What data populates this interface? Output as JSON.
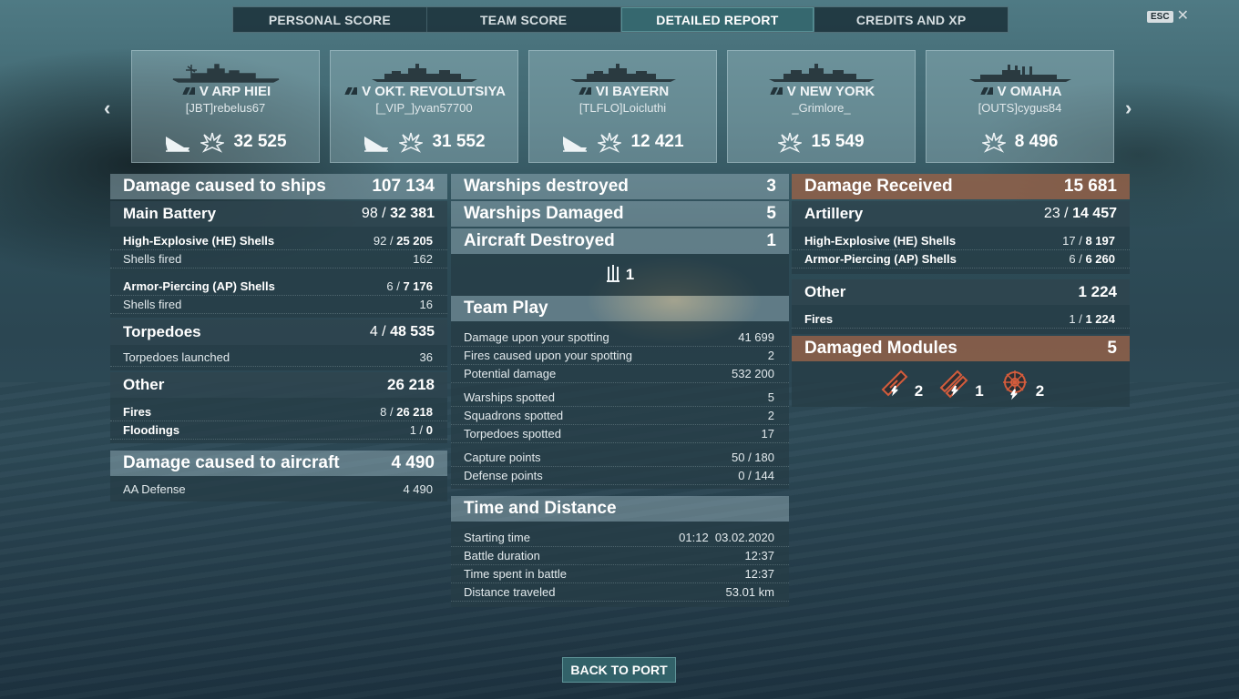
{
  "tabs": [
    "PERSONAL SCORE",
    "TEAM SCORE",
    "DETAILED REPORT",
    "CREDITS AND XP"
  ],
  "active_tab": 2,
  "esc_label": "ESC",
  "close_icon": "close-icon",
  "nav": {
    "prev_icon": "chevron-left-icon",
    "next_icon": "chevron-right-icon"
  },
  "ships": [
    {
      "tier_name": "V ARP HIEI",
      "player": "[JBT]rebelus67",
      "score": "32 525",
      "has_sunk_icon": true
    },
    {
      "tier_name": "V OKT. REVOLUTSIYA",
      "player": "[_VIP_]yvan57700",
      "score": "31 552",
      "has_sunk_icon": true
    },
    {
      "tier_name": "VI BAYERN",
      "player": "[TLFLO]Loicluthi",
      "score": "12 421",
      "has_sunk_icon": true
    },
    {
      "tier_name": "V NEW YORK",
      "player": "_Grimlore_",
      "score": "15 549",
      "has_sunk_icon": false
    },
    {
      "tier_name": "V OMAHA",
      "player": "[OUTS]cygus84",
      "score": "8 496",
      "has_sunk_icon": false
    }
  ],
  "damage_ships": {
    "title": "Damage caused to ships",
    "total": "107 134",
    "main_battery": {
      "label": "Main Battery",
      "hits": "98",
      "damage": "32 381"
    },
    "he": {
      "label": "High-Explosive (HE) Shells",
      "hits": "92",
      "damage": "25 205"
    },
    "he_fired": {
      "label": "Shells fired",
      "value": "162"
    },
    "ap": {
      "label": "Armor-Piercing (AP) Shells",
      "hits": "6",
      "damage": "7 176"
    },
    "ap_fired": {
      "label": "Shells fired",
      "value": "16"
    },
    "torpedoes": {
      "label": "Torpedoes",
      "hits": "4",
      "damage": "48 535"
    },
    "torp_launched": {
      "label": "Torpedoes launched",
      "value": "36"
    },
    "other": {
      "label": "Other",
      "total": "26 218"
    },
    "fires": {
      "label": "Fires",
      "hits": "8",
      "damage": "26 218"
    },
    "floodings": {
      "label": "Floodings",
      "hits": "1",
      "damage": "0"
    }
  },
  "damage_aircraft": {
    "title": "Damage caused to aircraft",
    "total": "4 490",
    "aa": {
      "label": "AA Defense",
      "value": "4 490"
    }
  },
  "center": {
    "warships_destroyed": {
      "label": "Warships destroyed",
      "value": "3"
    },
    "warships_damaged": {
      "label": "Warships Damaged",
      "value": "5"
    },
    "aircraft_destroyed": {
      "label": "Aircraft Destroyed",
      "value": "1"
    },
    "aircraft_icon_count": "1",
    "team_play": {
      "title": "Team Play",
      "rows": [
        {
          "label": "Damage upon your spotting",
          "value": "41 699"
        },
        {
          "label": "Fires caused upon your spotting",
          "value": "2"
        },
        {
          "label": "Potential damage",
          "value": "532 200"
        },
        {
          "label": "Warships spotted",
          "value": "5"
        },
        {
          "label": "Squadrons spotted",
          "value": "2"
        },
        {
          "label": "Torpedoes spotted",
          "value": "17"
        },
        {
          "label": "Capture points",
          "value": "50 / 180"
        },
        {
          "label": "Defense points",
          "value": "0 / 144"
        }
      ]
    },
    "time_distance": {
      "title": "Time and Distance",
      "rows": [
        {
          "label": "Starting time",
          "value": "01:12  03.02.2020"
        },
        {
          "label": "Battle duration",
          "value": "12:37"
        },
        {
          "label": "Time spent in battle",
          "value": "12:37"
        },
        {
          "label": "Distance traveled",
          "value": "53.01 km"
        }
      ]
    }
  },
  "received": {
    "title": "Damage Received",
    "total": "15 681",
    "artillery": {
      "label": "Artillery",
      "hits": "23",
      "damage": "14 457"
    },
    "he": {
      "label": "High-Explosive (HE) Shells",
      "hits": "17",
      "damage": "8 197"
    },
    "ap": {
      "label": "Armor-Piercing (AP) Shells",
      "hits": "6",
      "damage": "6 260"
    },
    "other": {
      "label": "Other",
      "total": "1 224"
    },
    "fires": {
      "label": "Fires",
      "hits": "1",
      "damage": "1 224"
    },
    "modules": {
      "title": "Damaged Modules",
      "total": "5",
      "items": [
        {
          "icon": "main-battery-turret-icon",
          "count": "2"
        },
        {
          "icon": "torpedo-tubes-icon",
          "count": "1"
        },
        {
          "icon": "steering-gear-icon",
          "count": "2"
        }
      ]
    }
  },
  "back_label": "BACK TO PORT",
  "colors": {
    "accent_tab": "#3e787e",
    "received_header": "#966248",
    "panel": "#263c46"
  }
}
